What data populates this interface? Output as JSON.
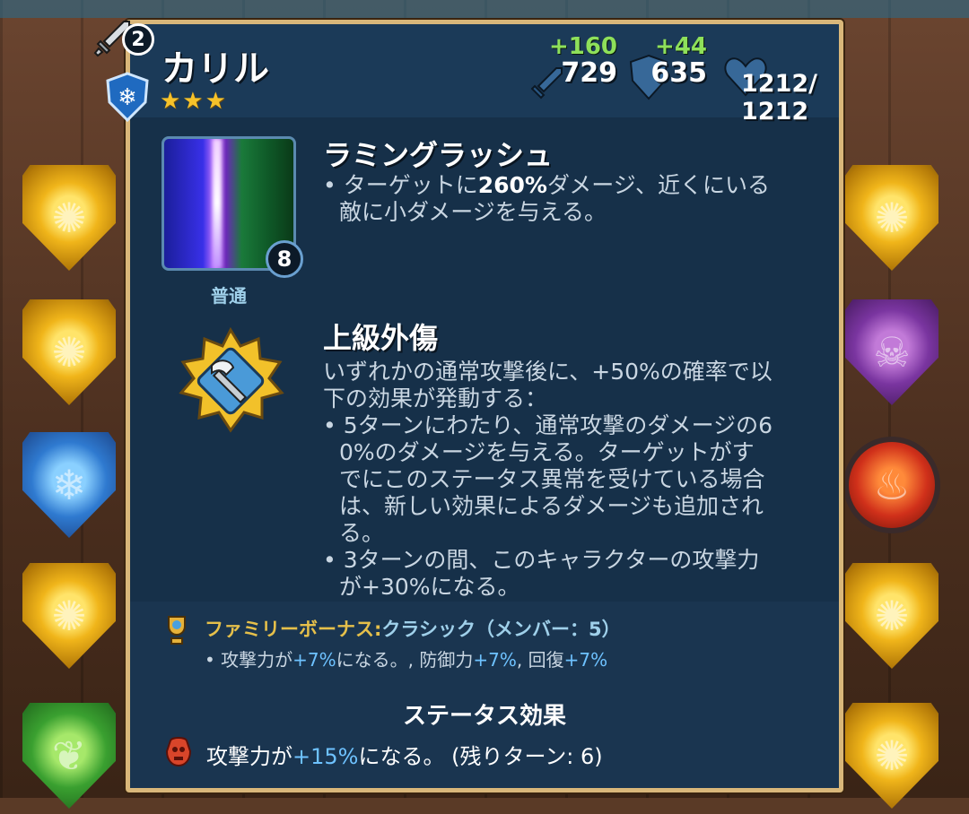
{
  "hero": {
    "name": "カリル",
    "stars": "★★★",
    "level": "2"
  },
  "stats": {
    "attack_bonus": "+160",
    "attack": "729",
    "defense_bonus": "+44",
    "defense": "635",
    "health": "1212/\n1212"
  },
  "special": {
    "name": "ラミングラッシュ",
    "mana": "8",
    "speed": "普通",
    "desc_1": "ターゲットに",
    "desc_pct": "260%",
    "desc_2": "ダメージ、近くにいる",
    "desc_line2": "敵に小ダメージを与える。"
  },
  "passive": {
    "name": "上級外傷",
    "lines": [
      "いずれかの通常攻撃後に、+50%の確率で以",
      "下の効果が発動する：",
      "• 5ターンにわたり、通常攻撃のダメージの6",
      "0%のダメージを与える。ターゲットがす",
      "でにこのステータス異常を受けている場合",
      "は、新しい効果によるダメージも追加され",
      "る。",
      "• 3ターンの間、このキャラクターの攻撃力",
      "が+30%になる。"
    ]
  },
  "family": {
    "label": "ファミリーボーナス:",
    "class_text": "クラシック（メンバー：5）",
    "bonus_prefix": "• 攻撃力が",
    "bonus_atk": "+7%",
    "bonus_mid1": "になる。, 防御力",
    "bonus_def": "+7%",
    "bonus_mid2": ", 回復",
    "bonus_heal": "+7%"
  },
  "status": {
    "title": "ステータス効果",
    "prefix": "攻撃力が",
    "pct": "+15%",
    "suffix": "になる。 (残りターン: 6)"
  },
  "colors": {
    "panel": "#163049",
    "border": "#d9b77a",
    "bonus_green": "#8ee05a",
    "percent_blue": "#6ec2ff",
    "family_gold": "#e6c04a"
  }
}
